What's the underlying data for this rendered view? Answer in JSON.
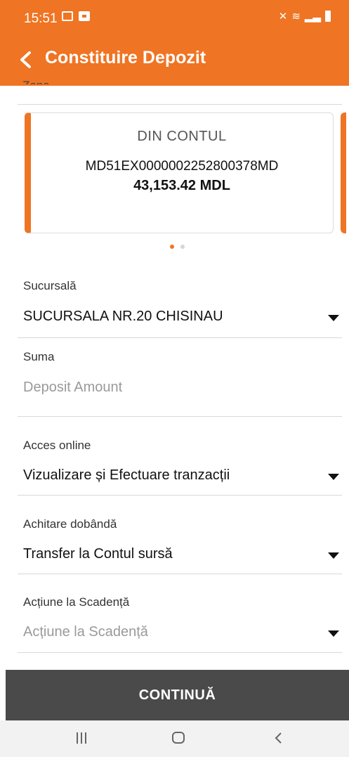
{
  "status_bar": {
    "time": "15:51"
  },
  "app_bar": {
    "title": "Constituire Depozit"
  },
  "clipped_label": "Zona",
  "card": {
    "label": "DIN CONTUL",
    "iban": "MD51EX0000002252800378MD",
    "balance": "43,153.42 MDL"
  },
  "form": {
    "branch": {
      "label": "Sucursală",
      "value": "SUCURSALA NR.20 CHISINAU"
    },
    "amount": {
      "label": "Suma",
      "placeholder": "Deposit Amount"
    },
    "online_access": {
      "label": "Acces online",
      "value": "Vizualizare și Efectuare tranzacții"
    },
    "interest_payment": {
      "label": "Achitare dobândă",
      "value": "Transfer la Contul sursă"
    },
    "maturity_action": {
      "label": "Acțiune la Scadență",
      "placeholder": "Acțiune la Scadență"
    }
  },
  "continue_label": "CONTINUĂ",
  "colors": {
    "accent": "#ef7423",
    "button": "#4a4a4a"
  }
}
